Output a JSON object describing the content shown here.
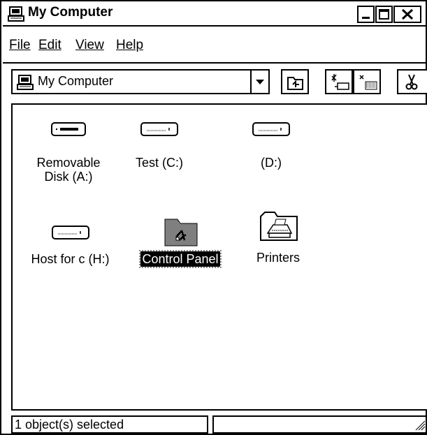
{
  "window": {
    "title": "My Computer"
  },
  "menu": [
    {
      "label": "File"
    },
    {
      "label": "Edit"
    },
    {
      "label": "View"
    },
    {
      "label": "Help"
    }
  ],
  "toolbar": {
    "location": "My Computer",
    "icons": [
      "dropdown-arrow-icon",
      "up-one-level-icon",
      "map-network-drive-icon",
      "disconnect-drive-icon",
      "cut-icon"
    ]
  },
  "items": [
    {
      "label": "Removable\nDisk (A:)",
      "icon": "floppy-drive-icon"
    },
    {
      "label": "Test (C:)",
      "icon": "hard-drive-icon"
    },
    {
      "label": "(D:)",
      "icon": "hard-drive-icon"
    },
    {
      "label": "Host for c (H:)",
      "icon": "hard-drive-icon"
    },
    {
      "label": "Control Panel",
      "icon": "control-panel-icon",
      "selected": true
    },
    {
      "label": "Printers",
      "icon": "printers-folder-icon"
    }
  ],
  "status": {
    "text": "1 object(s) selected"
  }
}
